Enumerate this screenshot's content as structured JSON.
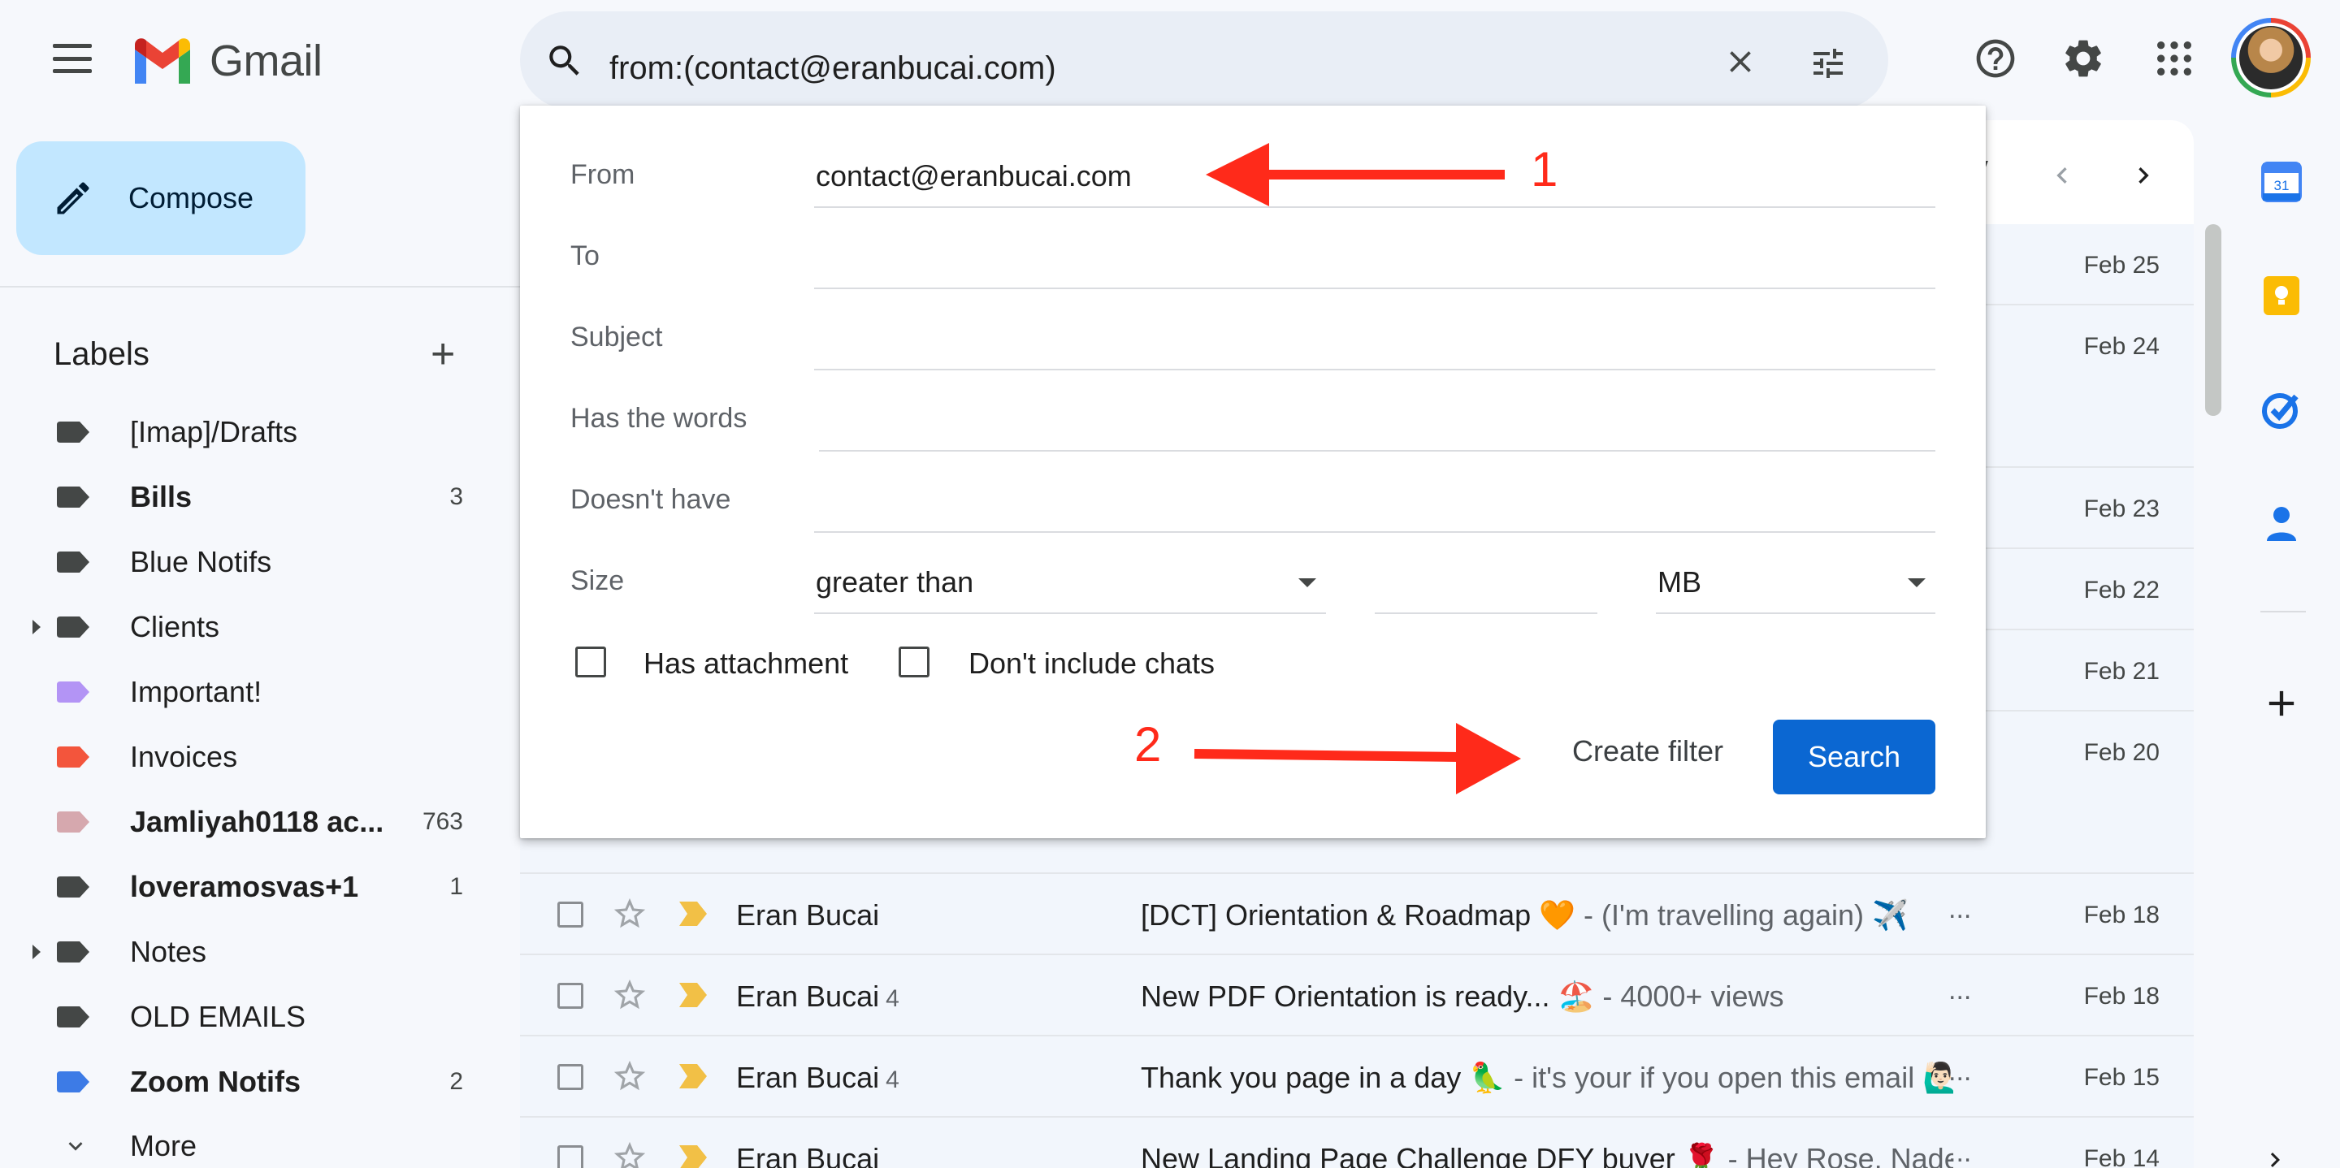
{
  "app": {
    "name": "Gmail"
  },
  "colors": {
    "accent": "#0b67d2",
    "compose_bg": "#c2e7ff",
    "annotation": "#ff2a1a"
  },
  "search": {
    "query": "from:(contact@eranbucai.com)"
  },
  "toolbar": {
    "help_icon": "help-icon",
    "settings_icon": "gear-icon",
    "apps_icon": "apps-grid-icon"
  },
  "sidebar": {
    "compose_label": "Compose",
    "labels_heading": "Labels",
    "labels": [
      {
        "name": "[Imap]/Drafts",
        "color": "#444746",
        "bold": false,
        "count": "",
        "expandable": false
      },
      {
        "name": "Bills",
        "color": "#444746",
        "bold": true,
        "count": "3",
        "expandable": false
      },
      {
        "name": "Blue Notifs",
        "color": "#444746",
        "bold": false,
        "count": "",
        "expandable": false
      },
      {
        "name": "Clients",
        "color": "#444746",
        "bold": false,
        "count": "",
        "expandable": true
      },
      {
        "name": "Important!",
        "color": "#b394f5",
        "bold": false,
        "count": "",
        "expandable": false
      },
      {
        "name": "Invoices",
        "color": "#f3553c",
        "bold": false,
        "count": "",
        "expandable": false
      },
      {
        "name": "Jamliyah0118 ac...",
        "color": "#d6a8ae",
        "bold": true,
        "count": "763",
        "expandable": false
      },
      {
        "name": "loveramosvas+1",
        "color": "#444746",
        "bold": true,
        "count": "1",
        "expandable": false
      },
      {
        "name": "Notes",
        "color": "#444746",
        "bold": false,
        "count": "",
        "expandable": true
      },
      {
        "name": "OLD EMAILS",
        "color": "#444746",
        "bold": false,
        "count": "",
        "expandable": false
      },
      {
        "name": "Zoom Notifs",
        "color": "#3d7be6",
        "bold": true,
        "count": "2",
        "expandable": false
      }
    ],
    "more_label": "More"
  },
  "pager": {
    "partial_text": "y"
  },
  "email_dates_behind": [
    "Feb 25",
    "Feb 24",
    "Feb 23",
    "Feb 22",
    "Feb 21",
    "Feb 20"
  ],
  "emails": [
    {
      "sender": "Eran Bucai",
      "count": "",
      "subject": "[DCT] Orientation & Roadmap 🧡",
      "snippet": " - (I'm travelling again) ✈️",
      "date": "Feb 18"
    },
    {
      "sender": "Eran Bucai",
      "count": "4",
      "subject": "New PDF Orientation is ready... 🏖️",
      "snippet": " - 4000+ views",
      "date": "Feb 18"
    },
    {
      "sender": "Eran Bucai",
      "count": "4",
      "subject": "Thank you page in a day 🦜",
      "snippet": " - it's your if you open this email 🙋🏻‍♂️...",
      "date": "Feb 15"
    },
    {
      "sender": "Eran Bucai",
      "count": "",
      "subject": "New Landing Page Challenge DFY buyer 🌹",
      "snippet": " - Hey Rose, Nadeg...",
      "date": "Feb 14"
    }
  ],
  "search_options": {
    "from_label": "From",
    "from_value": "contact@eranbucai.com",
    "to_label": "To",
    "to_value": "",
    "subject_label": "Subject",
    "subject_value": "",
    "has_words_label": "Has the words",
    "has_words_value": "",
    "doesnt_have_label": "Doesn't have",
    "doesnt_have_value": "",
    "size_label": "Size",
    "size_operator": "greater than",
    "size_value": "",
    "size_unit": "MB",
    "has_attachment_label": "Has attachment",
    "has_attachment_checked": false,
    "no_chats_label": "Don't include chats",
    "no_chats_checked": false,
    "create_filter_label": "Create filter",
    "search_button_label": "Search"
  },
  "annotations": {
    "step1": "1",
    "step2": "2"
  },
  "right_rail": [
    "calendar-icon",
    "keep-icon",
    "tasks-icon",
    "contacts-icon",
    "add-icon"
  ]
}
